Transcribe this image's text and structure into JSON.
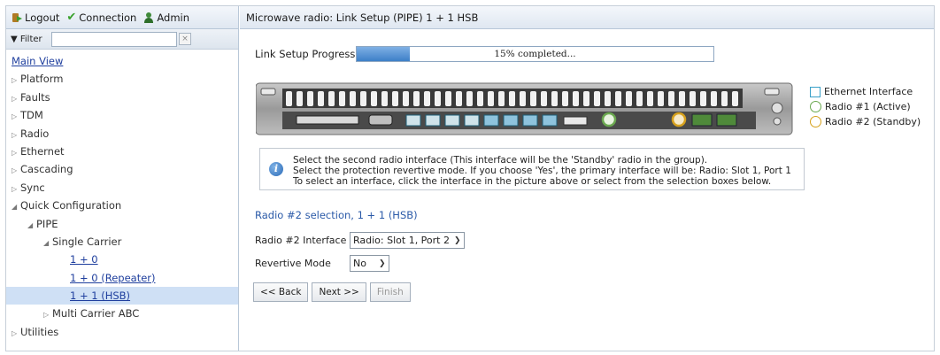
{
  "toolbar": {
    "logout": "Logout",
    "connection": "Connection",
    "admin": "Admin"
  },
  "filter": {
    "label": "▼ Filter",
    "value": "",
    "clear": "×"
  },
  "tree": [
    {
      "label": "Main View",
      "indent": 0,
      "arrow": "",
      "link": true
    },
    {
      "label": "Platform",
      "indent": 0,
      "arrow": "▷"
    },
    {
      "label": "Faults",
      "indent": 0,
      "arrow": "▷"
    },
    {
      "label": "TDM",
      "indent": 0,
      "arrow": "▷"
    },
    {
      "label": "Radio",
      "indent": 0,
      "arrow": "▷"
    },
    {
      "label": "Ethernet",
      "indent": 0,
      "arrow": "▷"
    },
    {
      "label": "Cascading",
      "indent": 0,
      "arrow": "▷"
    },
    {
      "label": "Sync",
      "indent": 0,
      "arrow": "▷"
    },
    {
      "label": "Quick Configuration",
      "indent": 0,
      "arrow": "◢"
    },
    {
      "label": "PIPE",
      "indent": 1,
      "arrow": "◢"
    },
    {
      "label": "Single Carrier",
      "indent": 2,
      "arrow": "◢"
    },
    {
      "label": "1 + 0",
      "indent": 3,
      "arrow": "",
      "link": true
    },
    {
      "label": "1 + 0 (Repeater)",
      "indent": 3,
      "arrow": "",
      "link": true
    },
    {
      "label": "1 + 1 (HSB)",
      "indent": 3,
      "arrow": "",
      "link": true,
      "selected": true
    },
    {
      "label": "Multi Carrier ABC",
      "indent": 2,
      "arrow": "▷"
    },
    {
      "label": "Utilities",
      "indent": 0,
      "arrow": "▷"
    }
  ],
  "header": {
    "title": "Microwave radio: Link Setup (PIPE) 1 + 1 HSB"
  },
  "progress": {
    "label": "Link Setup Progress",
    "percent": 15,
    "text": "15% completed..."
  },
  "legend": {
    "ethernet": "Ethernet Interface",
    "radio1": "Radio #1 (Active)",
    "radio2": "Radio #2 (Standby)"
  },
  "info": {
    "line1": "Select the second radio interface (This interface will be the 'Standby' radio in the group).",
    "line2": "Select the protection revertive mode. If you choose 'Yes', the primary interface will be: Radio: Slot 1, Port 1",
    "line3": "To select an interface, click the interface in the picture above or select from the selection boxes below."
  },
  "section": {
    "title": "Radio #2 selection, 1 + 1 (HSB)"
  },
  "form": {
    "radio2_label": "Radio #2 Interface",
    "radio2_value": "Radio: Slot 1, Port 2",
    "revertive_label": "Revertive Mode",
    "revertive_value": "No"
  },
  "buttons": {
    "back": "<< Back",
    "next": "Next >>",
    "finish": "Finish"
  },
  "colors": {
    "accent": "#2b5aa8",
    "progress": "#3d7fc8",
    "ethernet": "#3aa0c8",
    "radio1": "#6aa84f",
    "radio2": "#d6a11d"
  }
}
